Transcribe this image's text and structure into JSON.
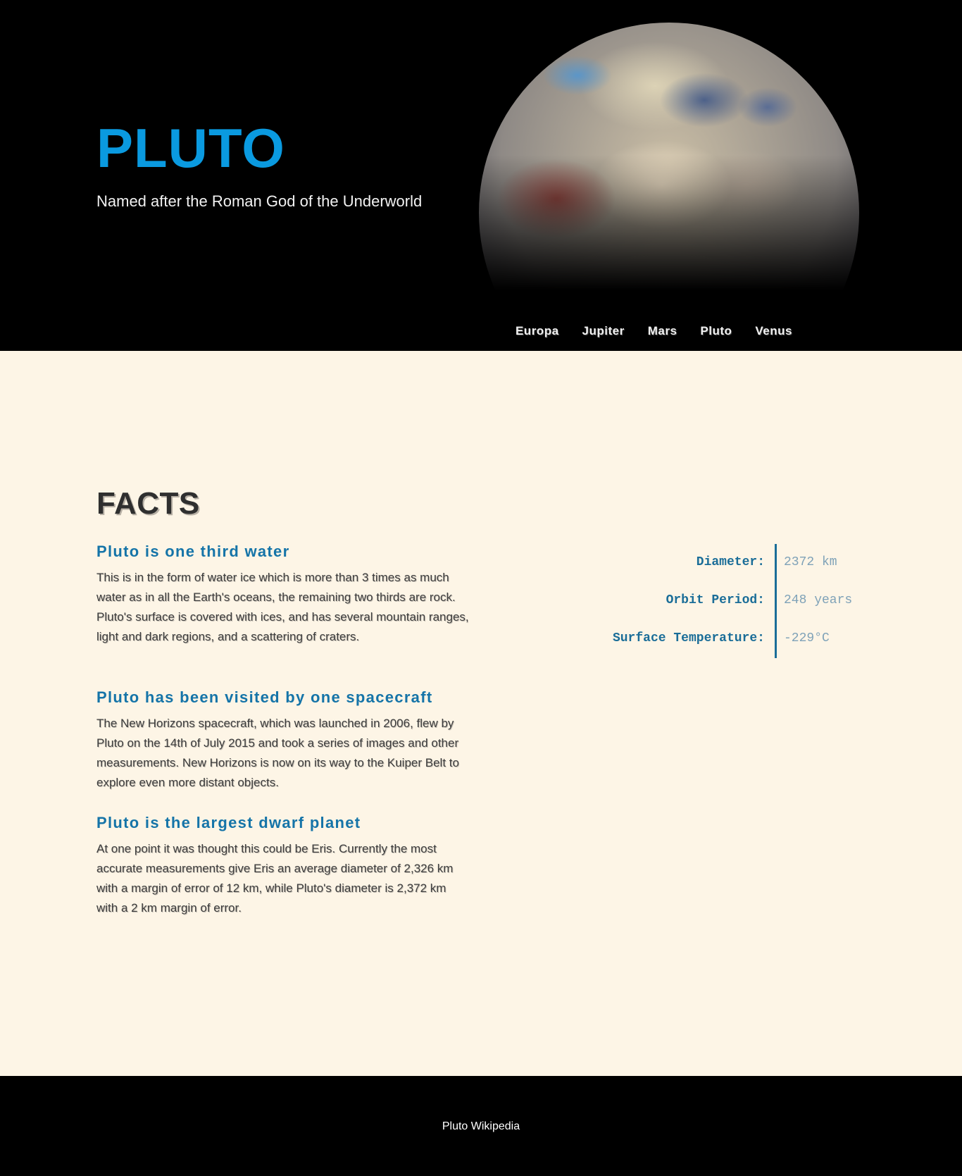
{
  "hero": {
    "title": "PLUTO",
    "subtitle": "Named after the Roman God of the Underworld"
  },
  "nav": {
    "items": [
      {
        "label": "Europa"
      },
      {
        "label": "Jupiter"
      },
      {
        "label": "Mars"
      },
      {
        "label": "Pluto"
      },
      {
        "label": "Venus"
      }
    ]
  },
  "facts": {
    "heading": "FACTS",
    "items": [
      {
        "title": "Pluto is one third water",
        "body": "This is in the form of water ice which is more than 3 times as much water as in all the Earth's oceans, the remaining two thirds are rock. Pluto's surface is covered with ices, and has several mountain ranges, light and dark regions, and a scattering of craters."
      },
      {
        "title": "Pluto has been visited by one spacecraft",
        "body": "The New Horizons spacecraft, which was launched in 2006, flew by Pluto on the 14th of July 2015 and took a series of images and other measurements. New Horizons is now on its way to the Kuiper Belt to explore even more distant objects."
      },
      {
        "title": "Pluto is the largest dwarf planet",
        "body": "At one point it was thought this could be Eris. Currently the most accurate measurements give Eris an average diameter of 2,326 km with a margin of error of 12 km, while Pluto's diameter is 2,372 km with a 2 km margin of error."
      }
    ]
  },
  "stats": {
    "rows": [
      {
        "label": "Diameter:",
        "value": "2372 km"
      },
      {
        "label": "Orbit Period:",
        "value": "248 years"
      },
      {
        "label": "Surface Temperature:",
        "value": "-229°C"
      }
    ]
  },
  "footer": {
    "link": "Pluto Wikipedia"
  },
  "colors": {
    "title_blue": "#0a9ae0",
    "heading_blue": "#1574a8",
    "page_background": "#fdf5e6",
    "header_background": "#000000"
  }
}
